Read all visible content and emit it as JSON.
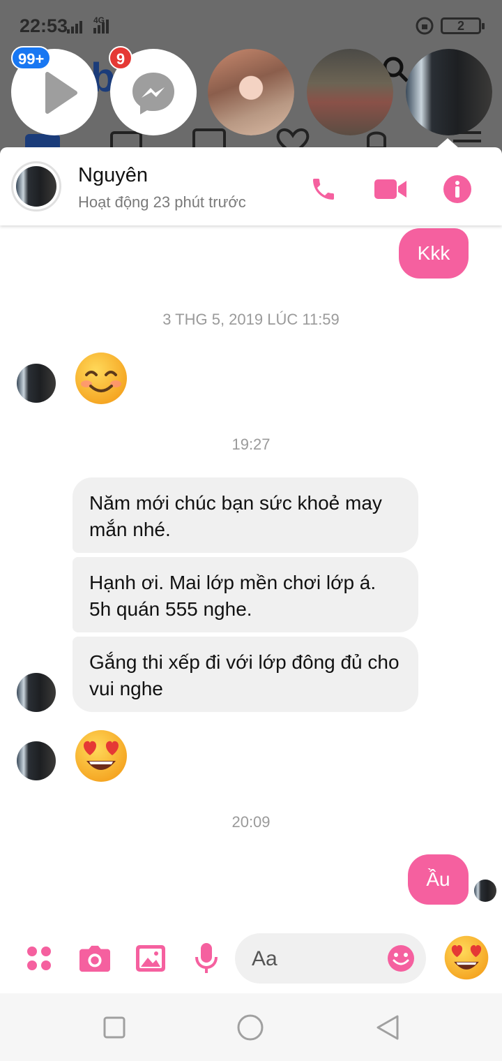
{
  "status_bar": {
    "time": "22:53",
    "network_label": "4G",
    "battery": "2"
  },
  "chat_heads": {
    "video_badge": "99+",
    "messenger_badge": "9"
  },
  "conversation": {
    "contact_name": "Nguyên",
    "contact_status": "Hoạt động 23 phút trước",
    "accent_color": "#f5609f"
  },
  "messages": {
    "out_1": "Kkk",
    "timestamp_1": "3 THG 5, 2019 LÚC 11:59",
    "timestamp_2": "19:27",
    "in_1": "Năm mới chúc bạn sức khoẻ may mắn nhé.",
    "in_2": "Hạnh ơi. Mai lớp mền chơi lớp á. 5h quán 555 nghe.",
    "in_3": "Gắng thi xếp đi với lớp đông đủ cho vui nghe",
    "timestamp_3": "20:09",
    "out_2": "Ầu"
  },
  "composer": {
    "placeholder": "Aa"
  },
  "icons": {
    "header": [
      "phone-icon",
      "video-camera-icon",
      "info-icon"
    ],
    "composer": [
      "apps-icon",
      "camera-icon",
      "gallery-icon",
      "microphone-icon",
      "smiley-icon",
      "heart-eyes-emoji"
    ],
    "nav": [
      "recent-apps-icon",
      "home-icon",
      "back-icon"
    ]
  }
}
